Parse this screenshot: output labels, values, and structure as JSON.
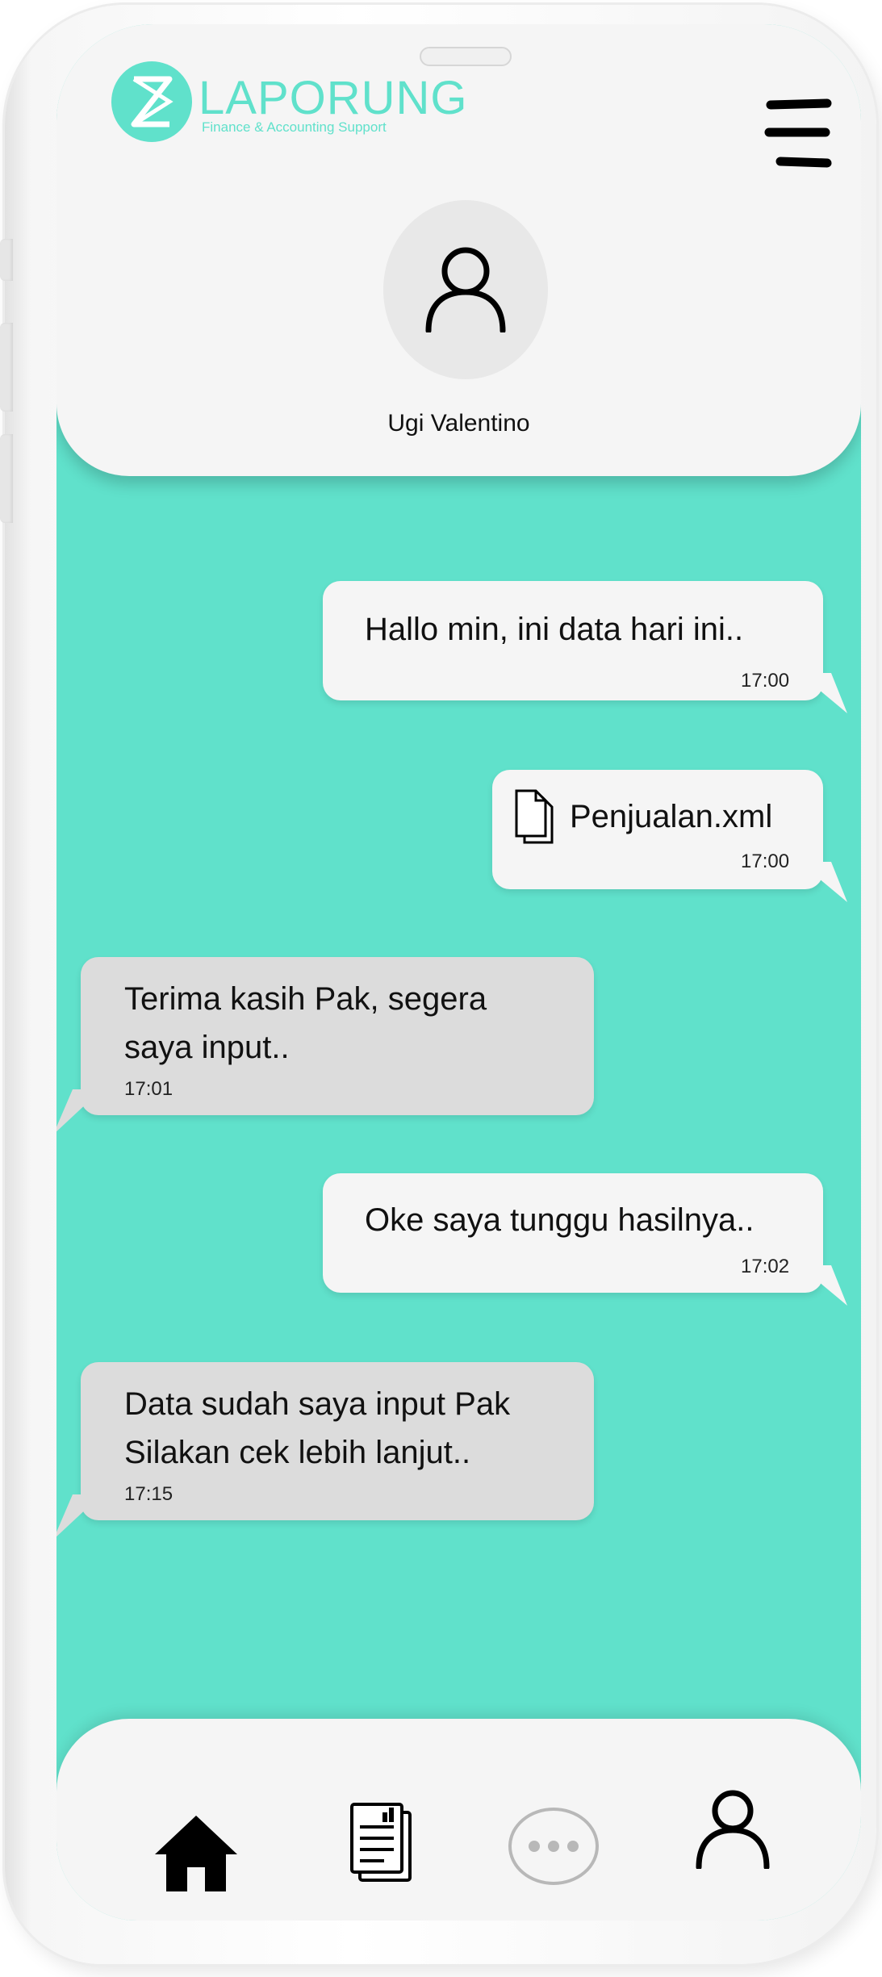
{
  "brand": {
    "name": "LAPORUNG",
    "tagline": "Finance & Accounting Support",
    "accent_color": "#60e1cb"
  },
  "header": {
    "menu_icon": "hamburger-menu-icon",
    "avatar_icon": "user-icon",
    "contact_name": "Ugi Valentino"
  },
  "messages": [
    {
      "direction": "outgoing",
      "text": "Hallo min, ini data hari ini..",
      "time": "17:00"
    },
    {
      "direction": "outgoing",
      "type": "file",
      "icon": "document-icon",
      "text": "Penjualan.xml",
      "time": "17:00"
    },
    {
      "direction": "incoming",
      "lines": [
        "Terima kasih Pak, segera",
        "saya input.."
      ],
      "time": "17:01"
    },
    {
      "direction": "outgoing",
      "text": "Oke saya tunggu hasilnya..",
      "time": "17:02"
    },
    {
      "direction": "incoming",
      "lines": [
        "Data sudah saya input Pak",
        "Silakan cek lebih lanjut.."
      ],
      "time": "17:15"
    }
  ],
  "bottom_nav": [
    {
      "icon": "home-icon",
      "active": true
    },
    {
      "icon": "report-document-icon",
      "active": false
    },
    {
      "icon": "chat-bubble-icon",
      "active": false
    },
    {
      "icon": "profile-icon",
      "active": false
    }
  ]
}
